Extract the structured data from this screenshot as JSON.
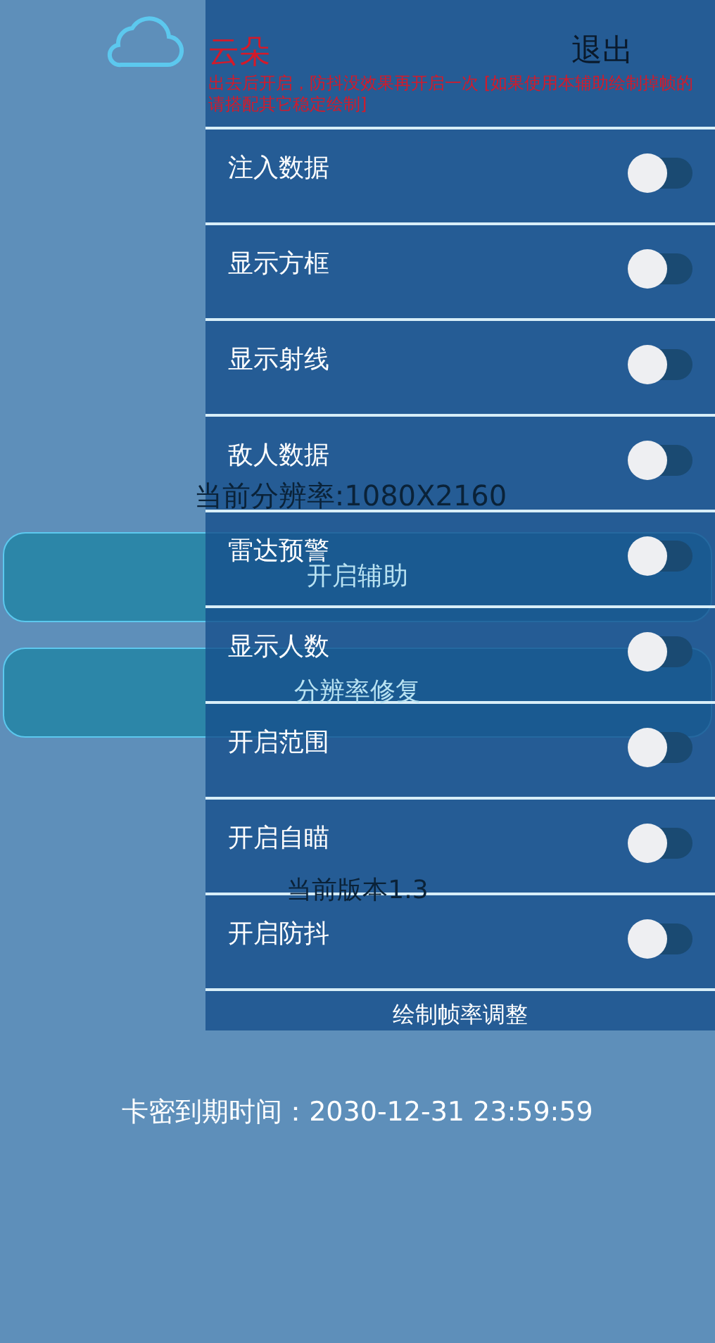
{
  "background": {
    "resolution": "当前分辨率:1080X2160",
    "buttons": [
      "开启辅助",
      "分辨率修复"
    ],
    "version": "当前版本1.3",
    "expiry": "卡密到期时间：2030-12-31 23:59:59"
  },
  "menu": {
    "title": "云朵",
    "exit": "退出",
    "notice": "出去后开启，防抖没效果再开启一次 [如果使用本辅助绘制掉帧的请搭配其它稳定绘制]",
    "switches": [
      {
        "label": "注入数据",
        "on": false
      },
      {
        "label": "显示方框",
        "on": false
      },
      {
        "label": "显示射线",
        "on": false
      },
      {
        "label": "敌人数据",
        "on": false
      },
      {
        "label": "雷达预警",
        "on": false
      },
      {
        "label": "显示人数",
        "on": false
      },
      {
        "label": "开启范围",
        "on": false
      },
      {
        "label": "开启自瞄",
        "on": false
      },
      {
        "label": "开启防抖",
        "on": false
      }
    ],
    "footer": "绘制帧率调整"
  }
}
